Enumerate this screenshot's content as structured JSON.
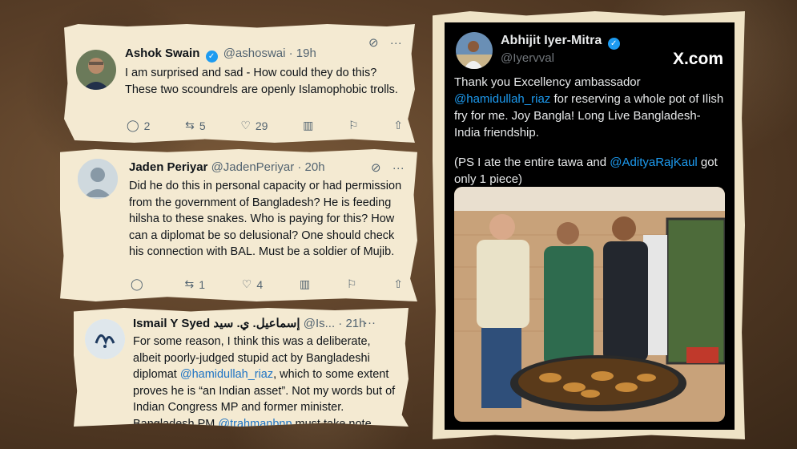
{
  "tweets": [
    {
      "name": "Ashok Swain",
      "handle": "@ashoswai",
      "time": "· 19h",
      "text": "I am surprised and sad - How could they do this? These two scoundrels are openly Islamophobic trolls.",
      "replies": "2",
      "reposts": "5",
      "likes": "29"
    },
    {
      "name": "Jaden Periyar",
      "handle": "@JadenPeriyar",
      "time": "· 20h",
      "text": "Did he do this in personal capacity or had permission from the government of Bangladesh? He is feeding hilsha to these snakes. Who is paying for this? How can a diplomat be so delusional? One should check his connection with BAL. Must be a soldier of Mujib.",
      "replies": "",
      "reposts": "1",
      "likes": "4"
    },
    {
      "name": "Ismail Y Syed إسماعيل. ي. سيد",
      "handle": "@Is...",
      "time": "· 21h",
      "text_pre": "For some reason, I think this was a deliberate, albeit poorly-judged stupid act by Bangladeshi diplomat ",
      "mention1": "@hamidullah_riaz",
      "text_mid": ", which to some extent proves he is “an Indian asset”. Not my words but of Indian Congress MP and former minister. Bangladesh PM ",
      "mention2": "@trahmanbnp",
      "text_post": " must take note."
    }
  ],
  "main_tweet": {
    "name": "Abhijit Iyer-Mitra",
    "handle": "@Iyervval",
    "site": "X.com",
    "text_a": "Thank you Excellency ambassador ",
    "mention_a": "@hamidullah_riaz",
    "text_b": " for reserving a whole pot of Ilish fry for me. Joy Bangla! Long Live Bangladesh-India friendship.",
    "text_c": "(PS I ate the entire tawa and ",
    "mention_b": "@AdityaRajKaul",
    "text_d": " got only 1 piece)"
  },
  "icons": [
    "grok-icon",
    "more-icon",
    "reply-icon",
    "repost-icon",
    "like-icon",
    "views-icon",
    "bookmark-icon",
    "share-icon",
    "verified-icon"
  ]
}
